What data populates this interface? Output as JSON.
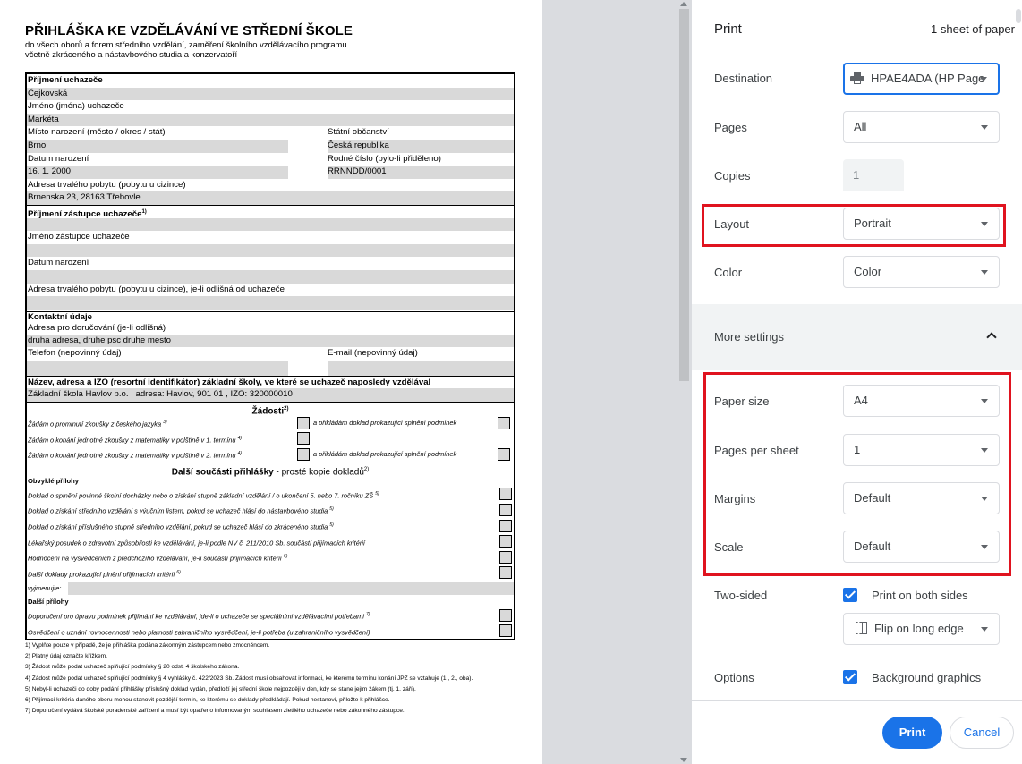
{
  "document": {
    "title": "PŘIHLÁŠKA KE VZDĚLÁVÁNÍ VE STŘEDNÍ ŠKOLE",
    "subtitle_1": "do všech oborů a forem středního vzdělání, zaměření školního vzdělávacího programu",
    "subtitle_2": "včetně zkráceného a nástavbového studia a konzervatoří",
    "applicant": {
      "surname_label": "Příjmení uchazeče",
      "surname": "Čejkovská",
      "name_label": "Jméno (jména) uchazeče",
      "name": "Markéta",
      "birthplace_label": "Místo narození (město / okres / stát)",
      "birthplace": "Brno",
      "citizenship_label": "Státní občanství",
      "citizenship": "Česká republika",
      "birthdate_label": "Datum narození",
      "birthdate": "16. 1. 2000",
      "birthnum_label": "Rodné číslo (bylo-li přiděleno)",
      "birthnum": "RRNNDD/0001",
      "address_label": "Adresa trvalého pobytu (pobytu u cizince)",
      "address": "Brnenska 23, 28163 Třebovle"
    },
    "representative": {
      "heading": "Příjmení zástupce uchazeče",
      "heading_sup": "1)",
      "name_label": "Jméno zástupce uchazeče",
      "birthdate_label": "Datum narození",
      "address_label": "Adresa trvalého pobytu (pobytu u cizince), je-li odlišná od uchazeče"
    },
    "contact": {
      "heading": "Kontaktní údaje",
      "mail_label": "Adresa pro doručování (je-li odlišná)",
      "mail_value": "druha adresa, druhe psc druhe mesto",
      "phone_label": "Telefon (nepovinný údaj)",
      "email_label": "E-mail (nepovinný údaj)"
    },
    "school": {
      "heading": "Název, adresa a IZO (resortní identifikátor) základní školy, ve které se uchazeč naposledy vzdělával",
      "value": "Základní škola Havlov p.o. , adresa: Havlov, 901 01 , IZO: 320000010"
    },
    "requests": {
      "heading": "Žádosti",
      "heading_sup": "2)",
      "items": [
        {
          "text": "Žádám o prominutí zkoušky z českého jazyka",
          "sup": "3)",
          "right": "a přikládám doklad prokazující splnění podmínek"
        },
        {
          "text": "Žádám o konání jednotné zkoušky z matematiky v polštině v 1. termínu",
          "sup": "4)",
          "right": ""
        },
        {
          "text": "Žádám o konání jednotné zkoušky z matematiky v polštině v 2. termínu",
          "sup": "4)",
          "right": "a přikládám doklad prokazující splnění podmínek"
        }
      ]
    },
    "attachments": {
      "heading_bold": "Další součásti přihlášky",
      "heading_rest": " - prosté kopie dokladů",
      "heading_sup": "2)",
      "usual_heading": "Obvyklé přílohy",
      "usual": [
        {
          "text": "Doklad o splnění povinné školní docházky nebo o získání stupně základní vzdělání / o ukončení 5. nebo 7. ročníku ZŠ",
          "sup": "5)"
        },
        {
          "text": "Doklad o získání středního vzdělání s výučním listem, pokud se uchazeč hlásí do nástavbového studia",
          "sup": "5)"
        },
        {
          "text": "Doklad o získání příslušného stupně středního vzdělání, pokud se uchazeč hlásí do zkráceného studia",
          "sup": "5)"
        },
        {
          "text": "Lékařský posudek o zdravotní způsobilosti ke vzdělávání, je-li podle NV č. 211/2010 Sb. součástí přijímacích kritérií",
          "sup": ""
        },
        {
          "text": "Hodnocení na vysvědčeních z předchozího vzdělávání, je-li součástí přijímacích kritérií",
          "sup": "6)"
        },
        {
          "text": "Další doklady prokazující plnění přijímacích kritérií",
          "sup": "6)"
        }
      ],
      "list_label": "vyjmenujte:",
      "other_heading": "Další přílohy",
      "other": [
        {
          "text": "Doporučení pro úpravu podmínek přijímání ke vzdělávání, jde-li o uchazeče se speciálními vzdělávacími potřebami",
          "sup": "7)"
        },
        {
          "text": "Osvědčení o uznání rovnocennosti nebo platnosti zahraničního vysvědčení, je-li potřeba (u zahraničního vysvědčení)",
          "sup": ""
        }
      ]
    },
    "footnotes": [
      "1) Vyplňte pouze v případě, že je přihláška podána zákonným zástupcem nebo zmocněncem.",
      "2) Platný údaj označte křížkem.",
      "3) Žádost může podat uchazeč splňující podmínky § 20 odst. 4 školského zákona.",
      "4) Žádost může podat uchazeč splňující podmínky § 4 vyhlášky č. 422/2023 Sb. Žádost musí obsahovat informaci, ke kterému termínu konání JPZ se vztahuje (1., 2., oba).",
      "5) Nebyl-li uchazeči do doby podání přihlášky příslušný doklad vydán, předloží jej střední škole nejpozději v den, kdy se stane jejím žákem (tj. 1. září).",
      "6) Přijímací kritéria daného oboru mohou stanovit pozdější termín, ke kterému se doklady předkládají. Pokud nestanoví, přiložte k přihlášce.",
      "7) Doporučení vydává školské poradenské zařízení a musí být opatřeno informovaným souhlasem zletilého uchazeče nebo zákonného zástupce."
    ]
  },
  "panel": {
    "title": "Print",
    "sheets": "1 sheet of paper",
    "destination": {
      "label": "Destination",
      "value": "HPAE4ADA (HP Page",
      "icon": "printer-icon"
    },
    "pages": {
      "label": "Pages",
      "value": "All"
    },
    "copies": {
      "label": "Copies",
      "value": "1"
    },
    "layout": {
      "label": "Layout",
      "value": "Portrait"
    },
    "color": {
      "label": "Color",
      "value": "Color"
    },
    "more_settings": {
      "label": "More settings",
      "icon": "chevron-up-icon"
    },
    "paper_size": {
      "label": "Paper size",
      "value": "A4"
    },
    "pages_per_sheet": {
      "label": "Pages per sheet",
      "value": "1"
    },
    "margins": {
      "label": "Margins",
      "value": "Default"
    },
    "scale": {
      "label": "Scale",
      "value": "Default"
    },
    "two_sided": {
      "label": "Two-sided",
      "checkbox_label": "Print on both sides",
      "flip_value": "Flip on long edge",
      "icon": "flip-long-edge-icon"
    },
    "options": {
      "label": "Options",
      "checkbox_label": "Background graphics"
    },
    "print_button": "Print",
    "cancel_button": "Cancel",
    "highlight_color": "#e0131f",
    "accent_color": "#1a73e8"
  }
}
